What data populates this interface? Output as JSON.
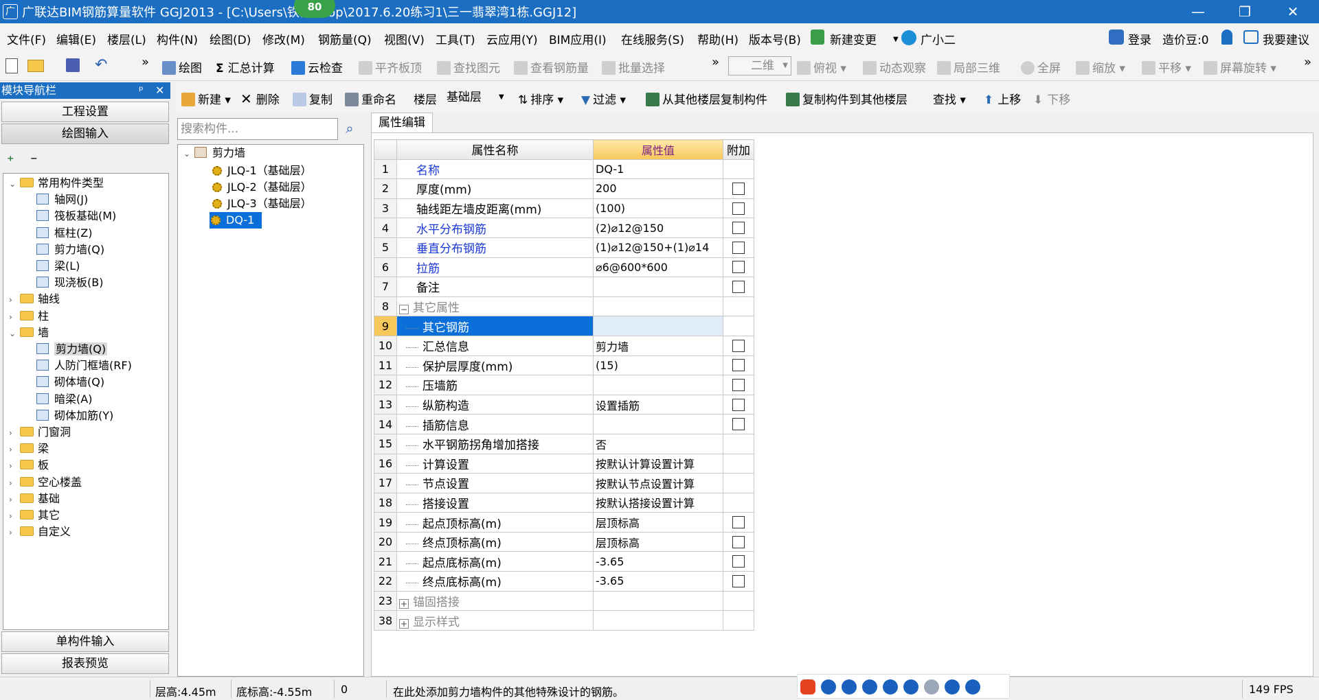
{
  "window": {
    "title": "广联达BIM钢筋算量软件 GGJ2013 - [C:\\Users\\铁镬 ktop\\2017.6.20练习1\\三一翡翠湾1栋.GGJ12]",
    "badge": "80"
  },
  "menu": [
    "文件(F)",
    "编辑(E)",
    "楼层(L)",
    "构件(N)",
    "绘图(D)",
    "修改(M)",
    "钢筋量(Q)",
    "视图(V)",
    "工具(T)",
    "云应用(Y)",
    "BIM应用(I)",
    "在线服务(S)",
    "帮助(H)",
    "版本号(B)",
    "新建变更",
    "广小二"
  ],
  "menu_right": {
    "login": "登录",
    "beans": "造价豆:0",
    "suggest": "我要建议"
  },
  "toolbar1": {
    "draw": "绘图",
    "sum": "汇总计算",
    "cloudcheck": "云检查",
    "flatroof": "平齐板顶",
    "findelem": "查找图元",
    "viewrebar": "查看钢筋量",
    "batchsel": "批量选择",
    "view2d": "二维",
    "topview": "俯视",
    "dynview": "动态观察",
    "local3d": "局部三维",
    "fullscreen": "全屏",
    "zoom": "缩放",
    "pan": "平移",
    "rotate": "屏幕旋转"
  },
  "nav": {
    "header": "模块导航栏",
    "btn_project": "工程设置",
    "btn_draw": "绘图输入",
    "btn_single": "单构件输入",
    "btn_report": "报表预览",
    "tree": [
      {
        "label": "常用构件类型",
        "level": 0,
        "kind": "folder",
        "open": true
      },
      {
        "label": "轴网(J)",
        "level": 1,
        "kind": "leaf"
      },
      {
        "label": "筏板基础(M)",
        "level": 1,
        "kind": "leaf"
      },
      {
        "label": "框柱(Z)",
        "level": 1,
        "kind": "leaf"
      },
      {
        "label": "剪力墙(Q)",
        "level": 1,
        "kind": "leaf"
      },
      {
        "label": "梁(L)",
        "level": 1,
        "kind": "leaf"
      },
      {
        "label": "现浇板(B)",
        "level": 1,
        "kind": "leaf"
      },
      {
        "label": "轴线",
        "level": 0,
        "kind": "folder",
        "open": false
      },
      {
        "label": "柱",
        "level": 0,
        "kind": "folder",
        "open": false
      },
      {
        "label": "墙",
        "level": 0,
        "kind": "folder",
        "open": true
      },
      {
        "label": "剪力墙(Q)",
        "level": 1,
        "kind": "leaf",
        "selected": true
      },
      {
        "label": "人防门框墙(RF)",
        "level": 1,
        "kind": "leaf"
      },
      {
        "label": "砌体墙(Q)",
        "level": 1,
        "kind": "leaf"
      },
      {
        "label": "暗梁(A)",
        "level": 1,
        "kind": "leaf"
      },
      {
        "label": "砌体加筋(Y)",
        "level": 1,
        "kind": "leaf"
      },
      {
        "label": "门窗洞",
        "level": 0,
        "kind": "folder",
        "open": false
      },
      {
        "label": "梁",
        "level": 0,
        "kind": "folder",
        "open": false
      },
      {
        "label": "板",
        "level": 0,
        "kind": "folder",
        "open": false
      },
      {
        "label": "空心楼盖",
        "level": 0,
        "kind": "folder",
        "open": false
      },
      {
        "label": "基础",
        "level": 0,
        "kind": "folder",
        "open": false
      },
      {
        "label": "其它",
        "level": 0,
        "kind": "folder",
        "open": false
      },
      {
        "label": "自定义",
        "level": 0,
        "kind": "folder",
        "open": false
      }
    ]
  },
  "toolbar2": {
    "new": "新建",
    "delete": "删除",
    "copy": "复制",
    "rename": "重命名",
    "floor_label": "楼层",
    "floor_value": "基础层",
    "sort": "排序",
    "filter": "过滤",
    "copy_from": "从其他楼层复制构件",
    "copy_to": "复制构件到其他楼层",
    "find": "查找",
    "up": "上移",
    "down": "下移"
  },
  "component_search": {
    "placeholder": "搜索构件..."
  },
  "component_tree": {
    "root": "剪力墙",
    "items": [
      "JLQ-1（基础层）",
      "JLQ-2（基础层）",
      "JLQ-3（基础层）",
      "DQ-1"
    ],
    "selected_index": 3
  },
  "props": {
    "tab": "属性编辑",
    "col_name": "属性名称",
    "col_value": "属性值",
    "col_extra": "附加",
    "rows": [
      {
        "n": "1",
        "name": "名称",
        "value": "DQ-1",
        "style": "blue",
        "cb": false
      },
      {
        "n": "2",
        "name": "厚度(mm)",
        "value": "200",
        "style": "",
        "cb": true
      },
      {
        "n": "3",
        "name": "轴线距左墙皮距离(mm)",
        "value": "(100)",
        "style": "",
        "cb": true
      },
      {
        "n": "4",
        "name": "水平分布钢筋",
        "value": "(2)⌀12@150",
        "style": "blue",
        "cb": true
      },
      {
        "n": "5",
        "name": "垂直分布钢筋",
        "value": "(1)⌀12@150+(1)⌀14",
        "style": "blue",
        "cb": true
      },
      {
        "n": "6",
        "name": "拉筋",
        "value": "⌀6@600*600",
        "style": "blue",
        "cb": true
      },
      {
        "n": "7",
        "name": "备注",
        "value": "",
        "style": "",
        "cb": true
      },
      {
        "n": "8",
        "name": "其它属性",
        "value": "",
        "style": "group",
        "sign": "−",
        "cb": false
      },
      {
        "n": "9",
        "name": "其它钢筋",
        "value": "",
        "style": "child",
        "cb": false,
        "selected": true
      },
      {
        "n": "10",
        "name": "汇总信息",
        "value": "剪力墙",
        "style": "child",
        "cb": true
      },
      {
        "n": "11",
        "name": "保护层厚度(mm)",
        "value": "(15)",
        "style": "child",
        "cb": true
      },
      {
        "n": "12",
        "name": "压墙筋",
        "value": "",
        "style": "child",
        "cb": true
      },
      {
        "n": "13",
        "name": "纵筋构造",
        "value": "设置插筋",
        "style": "child",
        "cb": true
      },
      {
        "n": "14",
        "name": "插筋信息",
        "value": "",
        "style": "child",
        "cb": true
      },
      {
        "n": "15",
        "name": "水平钢筋拐角增加搭接",
        "value": "否",
        "style": "child",
        "cb": false
      },
      {
        "n": "16",
        "name": "计算设置",
        "value": "按默认计算设置计算",
        "style": "child",
        "cb": false
      },
      {
        "n": "17",
        "name": "节点设置",
        "value": "按默认节点设置计算",
        "style": "child",
        "cb": false
      },
      {
        "n": "18",
        "name": "搭接设置",
        "value": "按默认搭接设置计算",
        "style": "child",
        "cb": false
      },
      {
        "n": "19",
        "name": "起点顶标高(m)",
        "value": "层顶标高",
        "style": "child",
        "cb": true
      },
      {
        "n": "20",
        "name": "终点顶标高(m)",
        "value": "层顶标高",
        "style": "child",
        "cb": true
      },
      {
        "n": "21",
        "name": "起点底标高(m)",
        "value": "-3.65",
        "style": "child",
        "cb": true
      },
      {
        "n": "22",
        "name": "终点底标高(m)",
        "value": "-3.65",
        "style": "child",
        "cb": true
      },
      {
        "n": "23",
        "name": "锚固搭接",
        "value": "",
        "style": "group",
        "sign": "+",
        "cb": false
      },
      {
        "n": "38",
        "name": "显示样式",
        "value": "",
        "style": "group",
        "sign": "+",
        "cb": false
      }
    ]
  },
  "status": {
    "floor_height": "层高:4.45m",
    "bottom_elev": "底标高:-4.55m",
    "zero": "0",
    "hint": "在此处添加剪力墙构件的其他特殊设计的钢筋。",
    "fps": "149 FPS"
  },
  "colors": {
    "titlebar": "#1b6ec2",
    "selection": "#0a6fd8",
    "header_value": "#f6c75a",
    "blue_text": "#1a37d6"
  }
}
